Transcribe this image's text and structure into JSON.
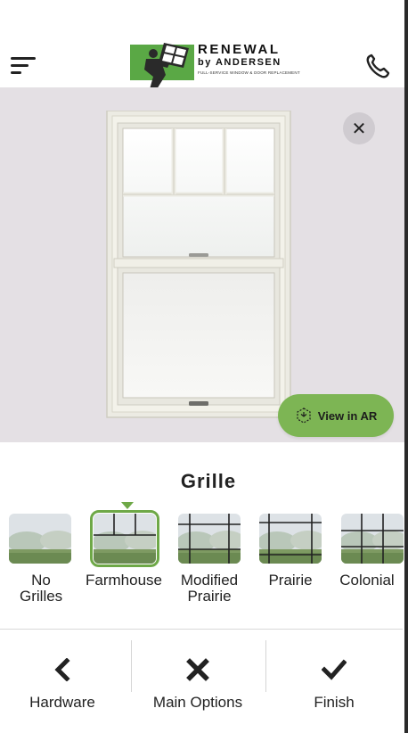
{
  "header": {
    "logo": {
      "line1": "RENEWAL",
      "line2": "by ANDERSEN",
      "tagline": "FULL-SERVICE WINDOW & DOOR REPLACEMENT"
    },
    "icons": {
      "menu": "menu-icon",
      "phone": "phone-icon"
    }
  },
  "preview": {
    "close_icon": "close-icon",
    "ar_button_label": "View in AR",
    "ar_icon": "ar-cube-icon"
  },
  "options": {
    "title": "Grille",
    "selected_index": 1,
    "items": [
      {
        "label": "No Grilles"
      },
      {
        "label": "Farmhouse"
      },
      {
        "label": "Modified Prairie"
      },
      {
        "label": "Prairie"
      },
      {
        "label": "Colonial"
      }
    ]
  },
  "nav": {
    "items": [
      {
        "label": "Hardware",
        "icon": "chevron-left-icon"
      },
      {
        "label": "Main Options",
        "icon": "x-icon"
      },
      {
        "label": "Finish",
        "icon": "checkmark-icon"
      }
    ]
  },
  "colors": {
    "brand_green": "#7db554",
    "selected_outline": "#6ea847",
    "preview_background": "#e4e0e4"
  }
}
